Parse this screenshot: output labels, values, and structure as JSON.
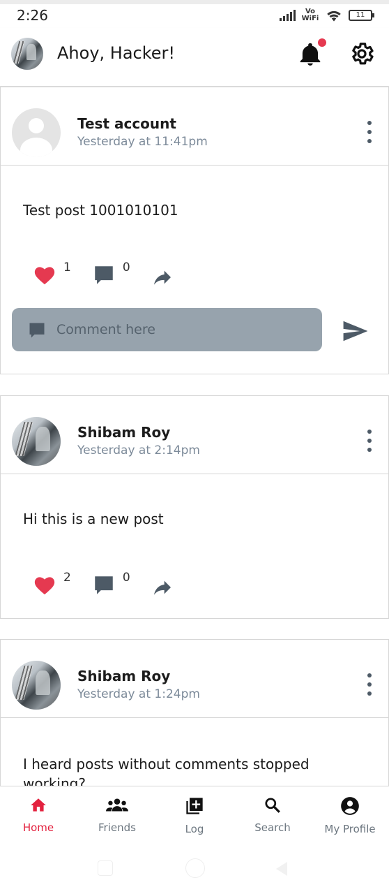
{
  "status_bar": {
    "time": "2:26",
    "network_label": "Vo WiFi",
    "battery": "11"
  },
  "header": {
    "greeting": "Ahoy, Hacker!"
  },
  "posts": [
    {
      "author": "Test account",
      "time": "Yesterday at 11:41pm",
      "text": "Test post 1001010101",
      "likes": "1",
      "comments": "0",
      "comment_placeholder": "Comment here"
    },
    {
      "author": "Shibam Roy",
      "time": "Yesterday at 2:14pm",
      "text": "Hi this is a new post",
      "likes": "2",
      "comments": "0"
    },
    {
      "author": "Shibam Roy",
      "time": "Yesterday at 1:24pm",
      "text": "I heard posts without comments stopped working?"
    }
  ],
  "bottom_nav": [
    {
      "label": "Home",
      "icon": "home-icon",
      "active": true
    },
    {
      "label": "Friends",
      "icon": "people-icon"
    },
    {
      "label": "Log",
      "icon": "add-box-icon"
    },
    {
      "label": "Search",
      "icon": "search-icon"
    },
    {
      "label": "My Profile",
      "icon": "account-circle-icon"
    }
  ],
  "colors": {
    "accent": "#e3223f",
    "heart": "#e53950",
    "comment_box": "#97a3ad",
    "timestamp": "#7c8a99",
    "icon_gray": "#4d5a66"
  }
}
